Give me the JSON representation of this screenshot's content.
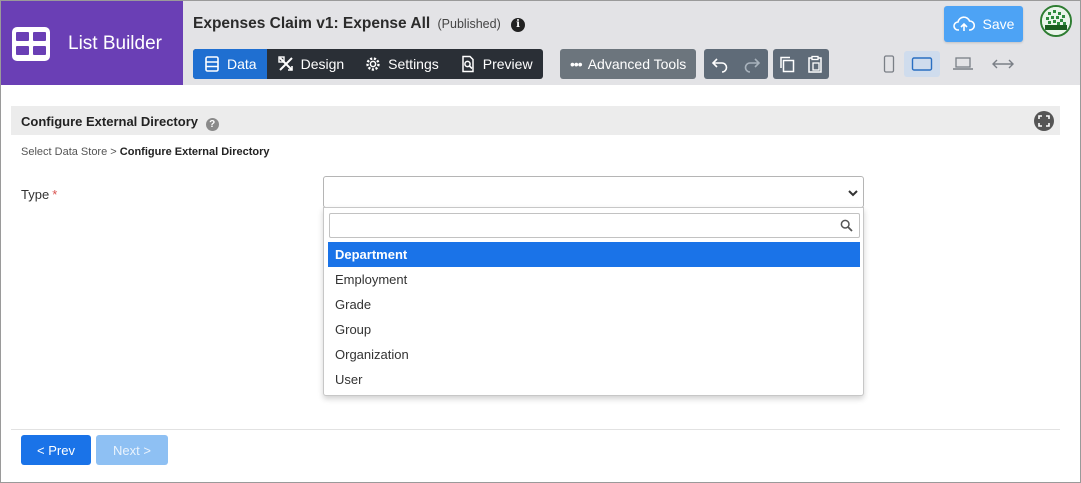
{
  "brand": {
    "title": "List Builder",
    "color": "#6a3fb5"
  },
  "header": {
    "title": "Expenses Claim v1: Expense All",
    "status": "(Published)",
    "info_icon": "info-icon",
    "save_label": "Save"
  },
  "toolbar": {
    "tabs": [
      {
        "label": "Data",
        "icon": "database-icon",
        "active": true
      },
      {
        "label": "Design",
        "icon": "design-tools-icon",
        "active": false
      },
      {
        "label": "Settings",
        "icon": "gear-icon",
        "active": false
      },
      {
        "label": "Preview",
        "icon": "preview-doc-icon",
        "active": false
      }
    ],
    "advanced_label": "Advanced Tools",
    "devices": [
      "phone-icon",
      "tablet-landscape-icon",
      "laptop-icon",
      "fit-width-icon"
    ],
    "active_device": "tablet-landscape-icon"
  },
  "section": {
    "title": "Configure External Directory"
  },
  "breadcrumb": {
    "parent": "Select Data Store",
    "separator": ">",
    "current": "Configure External Directory"
  },
  "form": {
    "type_label": "Type",
    "required_mark": "*",
    "dropdown_options": [
      "Department",
      "Employment",
      "Grade",
      "Group",
      "Organization",
      "User"
    ],
    "highlighted_option": "Department"
  },
  "nav": {
    "prev_label": "< Prev",
    "next_label": "Next >"
  },
  "colors": {
    "accent": "#1a73e8",
    "toolbar_dark": "#2a2f36",
    "save": "#4da3f5"
  }
}
